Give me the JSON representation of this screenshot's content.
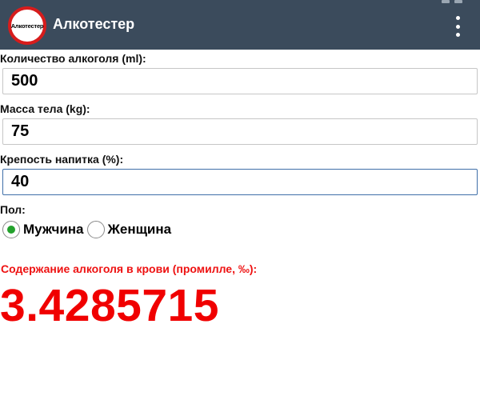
{
  "app": {
    "logo_text": "Алкотестер",
    "title": "Алкотестер"
  },
  "form": {
    "amount": {
      "label": "Количество алкоголя (ml):",
      "value": "500"
    },
    "weight": {
      "label": "Масса тела (kg):",
      "value": "75"
    },
    "strength": {
      "label": "Крепость напитка (%):",
      "value": "40"
    },
    "gender": {
      "label": "Пол:",
      "options": [
        {
          "label": "Мужчина",
          "selected": true
        },
        {
          "label": "Женщина",
          "selected": false
        }
      ]
    }
  },
  "result": {
    "caption": "Содержание алкоголя в крови (промилле, ‰):",
    "value": "3.4285715"
  },
  "colors": {
    "appbar": "#3b4b5c",
    "logo_ring": "#d71c1c",
    "result_red": "#f00000",
    "radio_selected": "#23a12c",
    "focus_border": "#3f6fa8"
  },
  "icons": {
    "menu": "more-vertical-icon"
  }
}
